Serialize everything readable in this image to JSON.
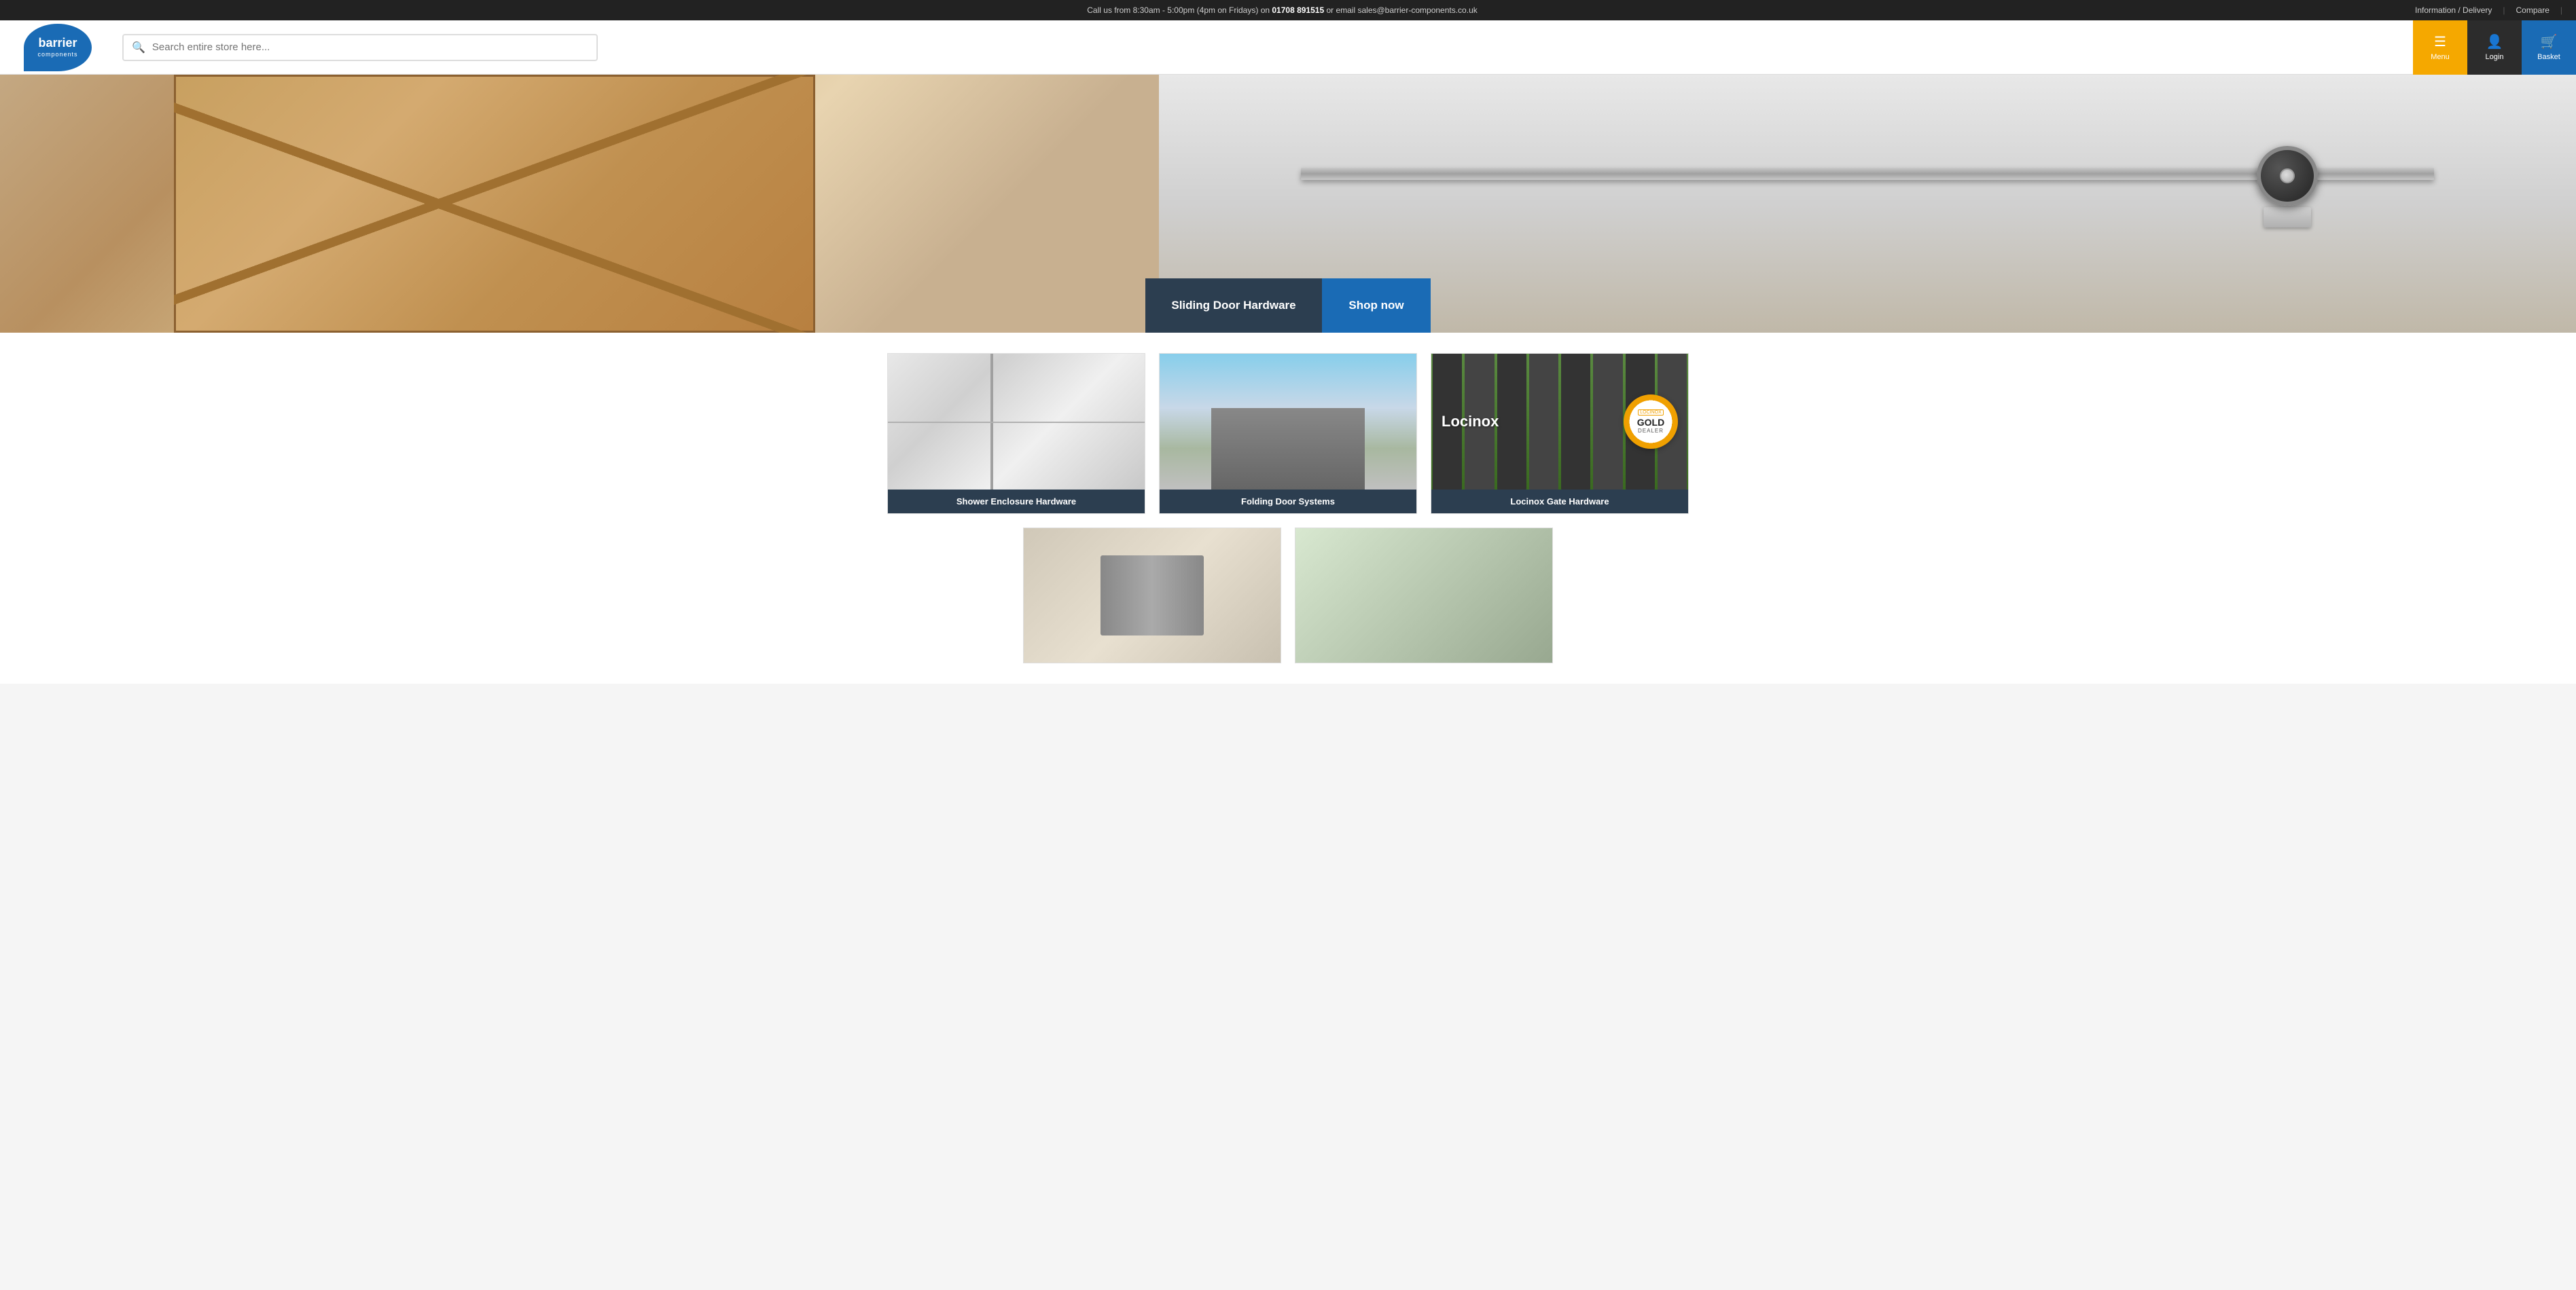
{
  "topbar": {
    "call_text": "Call us from 8:30am - 5:00pm (4pm on Fridays) on ",
    "phone": "01708 891515",
    "email_text": " or email ",
    "email": "sales@barrier-components.co.uk",
    "right": {
      "info": "Information / Delivery",
      "compare": "Compare"
    }
  },
  "header": {
    "logo": {
      "top": "barrier",
      "bottom": "components"
    },
    "search": {
      "placeholder": "Search entire store here..."
    },
    "menu_label": "Menu",
    "login_label": "Login",
    "basket_label": "Basket"
  },
  "hero": {
    "title": "Sliding Door Hardware",
    "cta": "Shop now"
  },
  "products": [
    {
      "type": "shower",
      "label": "Shower Enclosure Hardware"
    },
    {
      "type": "building",
      "label": "Folding Door Systems"
    },
    {
      "type": "gate",
      "label": "Locinox Gate Hardware",
      "locinox_brand": "LOCINOX",
      "locinox_gold": "GOLD",
      "locinox_dealer": "DEALER",
      "locinox_name": "Locinox"
    }
  ],
  "second_row": [
    {
      "type": "hinges",
      "label": ""
    },
    {
      "type": "placeholder2",
      "label": ""
    }
  ]
}
